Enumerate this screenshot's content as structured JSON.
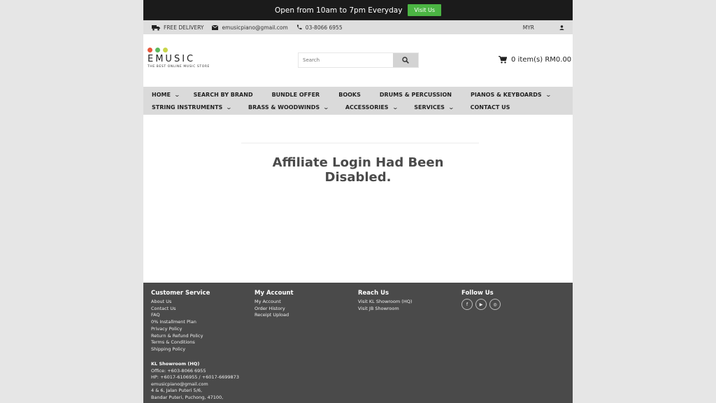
{
  "announcement": {
    "text": "Open from 10am to 7pm Everyday",
    "button": "Visit Us"
  },
  "topbar": {
    "delivery": "FREE DELIVERY",
    "email": "emusicpiano@gmail.com",
    "phone": "03-8066 6955",
    "currency": "MYR",
    "icons": [
      "truck-icon",
      "mail-icon",
      "phone-icon",
      "user-icon"
    ]
  },
  "logo": {
    "name": "EMUSIC",
    "tagline": "THE BEST ONLINE MUSIC STORE",
    "dot_colors": [
      "#e8573a",
      "#5cb85c",
      "#c9d64a"
    ]
  },
  "search": {
    "placeholder": "Search"
  },
  "cart": {
    "label": "0 item(s) RM0.00"
  },
  "nav": {
    "row1": [
      {
        "label": "HOME",
        "has_dropdown": true
      },
      {
        "label": "SEARCH BY BRAND",
        "has_dropdown": false
      },
      {
        "label": "BUNDLE OFFER",
        "has_dropdown": false
      },
      {
        "label": "BOOKS",
        "has_dropdown": false
      },
      {
        "label": "DRUMS & PERCUSSION",
        "has_dropdown": false
      },
      {
        "label": "PIANOS & KEYBOARDS",
        "has_dropdown": true
      }
    ],
    "row2": [
      {
        "label": "STRING INSTRUMENTS",
        "has_dropdown": true
      },
      {
        "label": "BRASS & WOODWINDS",
        "has_dropdown": true
      },
      {
        "label": "ACCESSORIES",
        "has_dropdown": true
      },
      {
        "label": "SERVICES",
        "has_dropdown": true
      },
      {
        "label": "CONTACT US",
        "has_dropdown": false
      }
    ]
  },
  "main": {
    "message_line1": "Affiliate Login Had Been",
    "message_line2": "Disabled."
  },
  "footer": {
    "customer_service": {
      "title": "Customer Service",
      "links": [
        "About Us",
        "Contact Us",
        "FAQ",
        "0% Installment Plan",
        "Privacy Policy",
        "Return & Refund Policy",
        "Terms & Conditions",
        "Shipping Policy"
      ]
    },
    "my_account": {
      "title": "My Account",
      "links": [
        "My Account",
        "Order History",
        "Receipt Upload"
      ]
    },
    "reach_us": {
      "title": "Reach Us",
      "links": [
        "Visit KL Showroom (HQ)",
        "Visit JB Showroom"
      ]
    },
    "follow_us": {
      "title": "Follow Us",
      "icons": [
        "facebook-icon",
        "youtube-icon",
        "instagram-icon"
      ],
      "glyphs": [
        "f",
        "▶",
        "◎"
      ]
    },
    "showroom": {
      "title": "KL Showroom (HQ)",
      "lines": [
        "Office: +603-8066 6955",
        "HP: +6017-6106955 / +6017-6699873",
        "emusicpiano@gmail.com",
        "4 & 6, Jalan Puteri 5/6,",
        "Bandar Puteri, Puchong, 47100,"
      ]
    }
  },
  "colors": {
    "announce_bg": "#1b1b1b",
    "visit_btn": "#4bb543",
    "topbar_bg": "#dedede",
    "nav_bg": "#dadada",
    "footer_bg": "#4a4a4a"
  }
}
